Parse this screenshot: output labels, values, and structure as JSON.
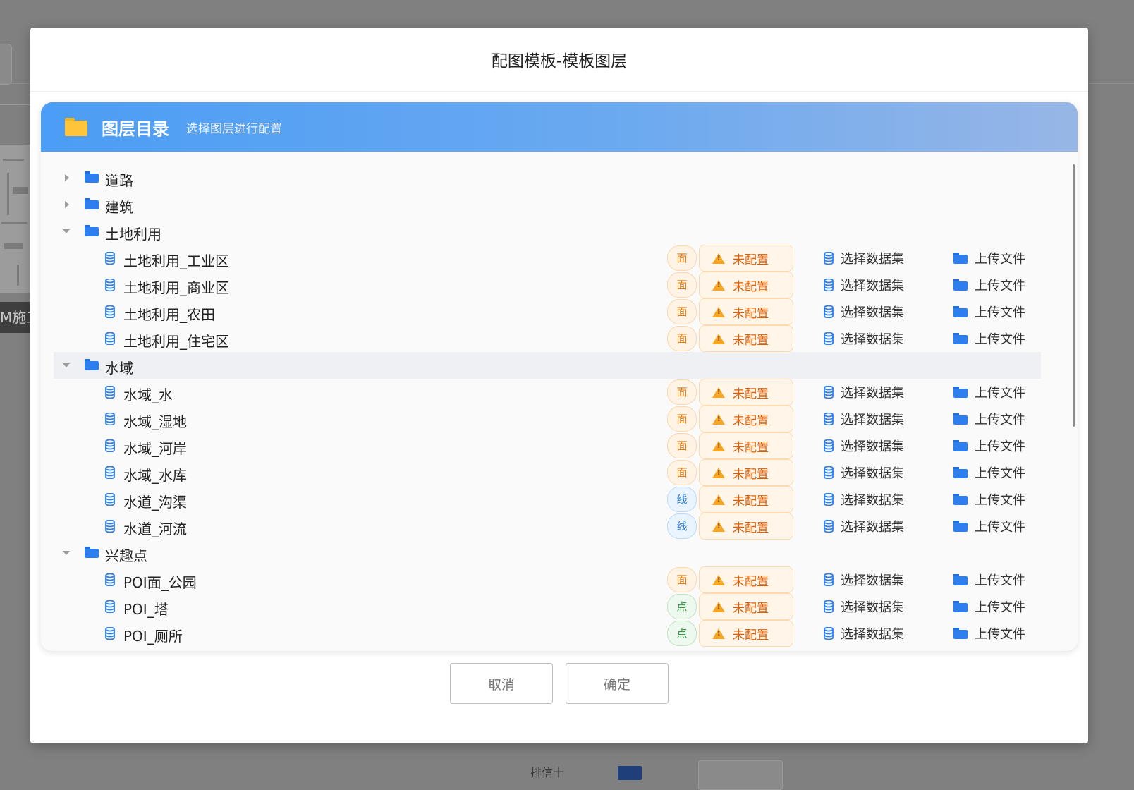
{
  "background": {
    "side_label": "M施工",
    "bottom_text": "排信十"
  },
  "modal": {
    "title": "配图模板-模板图层"
  },
  "panel": {
    "title": "图层目录",
    "subtitle": "选择图层进行配置"
  },
  "actions": {
    "dataset_label": "选择数据集",
    "upload_label": "上传文件"
  },
  "status_label": "未配置",
  "type_labels": {
    "face": "面",
    "line": "线",
    "point": "点"
  },
  "tree": [
    {
      "kind": "folder",
      "label": "道路",
      "expanded": false
    },
    {
      "kind": "folder",
      "label": "建筑",
      "expanded": false
    },
    {
      "kind": "folder",
      "label": "土地利用",
      "expanded": true
    },
    {
      "kind": "layer",
      "label": "土地利用_工业区",
      "type": "面"
    },
    {
      "kind": "layer",
      "label": "土地利用_商业区",
      "type": "面"
    },
    {
      "kind": "layer",
      "label": "土地利用_农田",
      "type": "面"
    },
    {
      "kind": "layer",
      "label": "土地利用_住宅区",
      "type": "面"
    },
    {
      "kind": "folder",
      "label": "水域",
      "expanded": true,
      "highlighted": true
    },
    {
      "kind": "layer",
      "label": "水域_水",
      "type": "面"
    },
    {
      "kind": "layer",
      "label": "水域_湿地",
      "type": "面"
    },
    {
      "kind": "layer",
      "label": "水域_河岸",
      "type": "面"
    },
    {
      "kind": "layer",
      "label": "水域_水库",
      "type": "面"
    },
    {
      "kind": "layer",
      "label": "水道_沟渠",
      "type": "线"
    },
    {
      "kind": "layer",
      "label": "水道_河流",
      "type": "线"
    },
    {
      "kind": "folder",
      "label": "兴趣点",
      "expanded": true
    },
    {
      "kind": "layer",
      "label": "POI面_公园",
      "type": "面"
    },
    {
      "kind": "layer",
      "label": "POI_塔",
      "type": "点"
    },
    {
      "kind": "layer",
      "label": "POI_厕所",
      "type": "点"
    }
  ],
  "footer": {
    "cancel_label": "取消",
    "confirm_label": "确定"
  }
}
